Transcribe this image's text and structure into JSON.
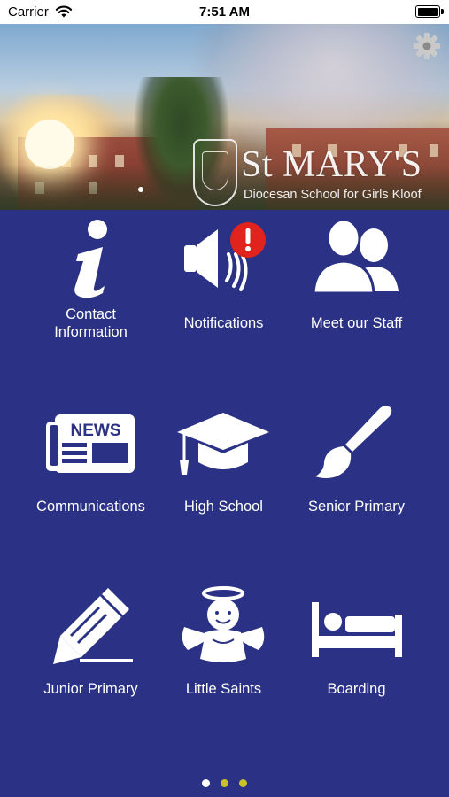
{
  "status_bar": {
    "carrier": "Carrier",
    "time": "7:51 AM",
    "wifi_icon": "wifi-icon",
    "battery_icon": "battery-icon"
  },
  "banner": {
    "school_name": "St MARY'S",
    "school_subtitle": "Diocesan School for Girls Kloof",
    "settings_icon": "gear-icon"
  },
  "menu": {
    "items": [
      {
        "label_line1": "Contact",
        "label_line2": "Information",
        "icon": "info-icon"
      },
      {
        "label": "Notifications",
        "icon": "notification-speaker-icon"
      },
      {
        "label": "Meet our Staff",
        "icon": "people-icon"
      },
      {
        "label": "Communications",
        "icon": "newspaper-icon"
      },
      {
        "label": "High School",
        "icon": "graduation-cap-icon"
      },
      {
        "label": "Senior Primary",
        "icon": "paintbrush-icon"
      },
      {
        "label": "Junior Primary",
        "icon": "pencil-icon"
      },
      {
        "label": "Little Saints",
        "icon": "angel-icon"
      },
      {
        "label": "Boarding",
        "icon": "bed-icon"
      }
    ],
    "news_text": "NEWS"
  },
  "pager": {
    "pages": 3,
    "current": 1
  },
  "colors": {
    "background": "#2b3285",
    "pager_active": "#ffffff",
    "pager_inactive": "#c9c02a",
    "notification_badge": "#e0231d"
  }
}
